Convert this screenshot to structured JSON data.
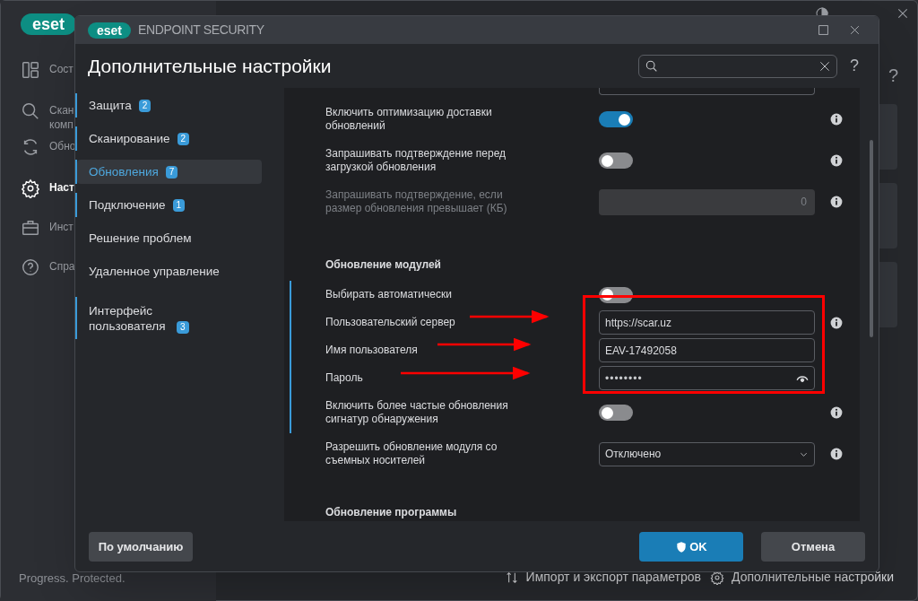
{
  "main_window": {
    "logo": "eset",
    "nav": [
      {
        "lines": [
          "Сост"
        ],
        "selected": false
      },
      {
        "lines": [
          "Скан",
          "комп"
        ],
        "selected": false
      },
      {
        "lines": [
          "Обно"
        ],
        "selected": false
      },
      {
        "lines": [
          "Наст"
        ],
        "selected": true
      },
      {
        "lines": [
          "Инст"
        ],
        "selected": false
      },
      {
        "lines": [
          "Спра"
        ],
        "selected": false
      }
    ],
    "help": "?",
    "tagline": "Progress. Protected.",
    "footer_links": [
      "Импорт и экспорт параметров",
      "Дополнительные настройки"
    ]
  },
  "dialog": {
    "logo": "eset",
    "title": "ENDPOINT SECURITY",
    "heading": "Дополнительные настройки",
    "help": "?",
    "sidebar": [
      {
        "label": "Защита",
        "badge": "2",
        "selected": false
      },
      {
        "label": "Сканирование",
        "badge": "2",
        "selected": false
      },
      {
        "label": "Обновления",
        "badge": "7",
        "selected": true
      },
      {
        "label": "Подключение",
        "badge": "1",
        "selected": false
      },
      {
        "label": "Решение проблем",
        "selected": false
      },
      {
        "label": "Удаленное управление",
        "selected": false
      },
      {
        "label": "Интерфейс пользователя",
        "badge": "3",
        "selected": false
      }
    ],
    "settings": [
      {
        "kind": "clipped_field"
      },
      {
        "kind": "toggle",
        "label": "Включить оптимизацию доставки обновлений",
        "on": true,
        "info": true,
        "modified": false
      },
      {
        "kind": "toggle",
        "label": "Запрашивать подтверждение перед загрузкой обновления",
        "on": false,
        "info": true,
        "modified": false
      },
      {
        "kind": "number",
        "label": "Запрашивать подтверждение, если размер обновления превышает (КБ)",
        "value": "0",
        "disabled": true,
        "info": true,
        "modified": false
      },
      {
        "kind": "heading",
        "label": "Обновление модулей"
      },
      {
        "kind": "toggle",
        "label": "Выбирать автоматически",
        "on": false,
        "info": false,
        "modified": true
      },
      {
        "kind": "text",
        "label": "Пользовательский сервер",
        "value": "https://scar.uz",
        "info": true,
        "modified": true
      },
      {
        "kind": "text",
        "label": "Имя пользователя",
        "value": "EAV-17492058",
        "info": false,
        "modified": true
      },
      {
        "kind": "password",
        "label": "Пароль",
        "value": "••••••••",
        "info": false,
        "modified": true
      },
      {
        "kind": "toggle",
        "label": "Включить более частые обновления сигнатур обнаружения",
        "on": false,
        "info": true,
        "modified": true
      },
      {
        "kind": "select",
        "label": "Разрешить обновление модуля со съемных носителей",
        "value": "Отключено",
        "info": true,
        "modified": false
      },
      {
        "kind": "heading",
        "label": "Обновление программы"
      }
    ],
    "buttons": [
      {
        "kind": "default",
        "label": "По умолчанию"
      },
      {
        "kind": "primary",
        "label": "OK"
      },
      {
        "kind": "cancel",
        "label": "Отмена"
      }
    ]
  }
}
